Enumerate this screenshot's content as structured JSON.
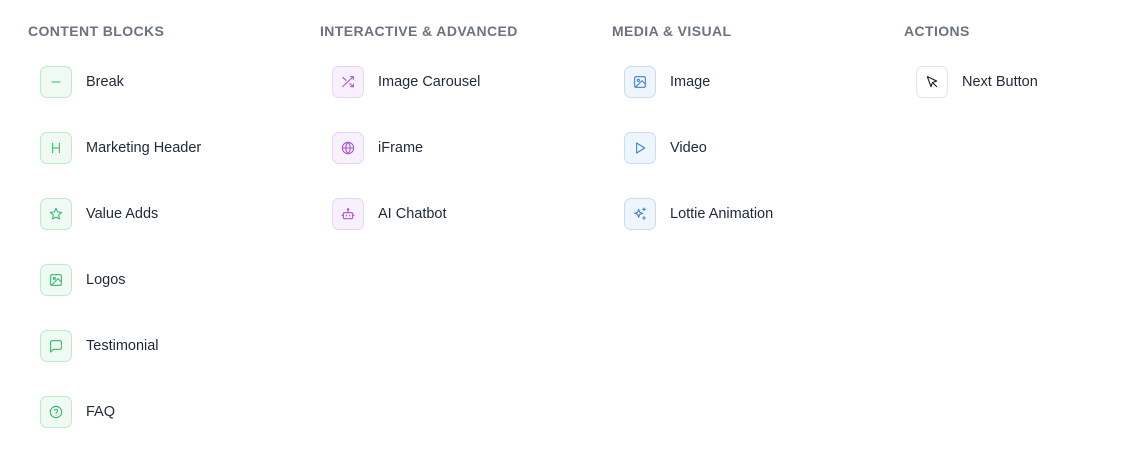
{
  "colors": {
    "content_accent": "#35b86a",
    "interactive_accent": "#a353d8",
    "media_accent": "#3d82cc",
    "actions_accent": "#111827",
    "heading_text": "#6b7280"
  },
  "columns": [
    {
      "title": "CONTENT BLOCKS",
      "items": [
        {
          "label": "Break",
          "icon": "minus-icon"
        },
        {
          "label": "Marketing Header",
          "icon": "heading-icon"
        },
        {
          "label": "Value Adds",
          "icon": "star-icon"
        },
        {
          "label": "Logos",
          "icon": "image-icon"
        },
        {
          "label": "Testimonial",
          "icon": "message-square-icon"
        },
        {
          "label": "FAQ",
          "icon": "help-circle-icon"
        }
      ]
    },
    {
      "title": "INTERACTIVE & ADVANCED",
      "items": [
        {
          "label": "Image Carousel",
          "icon": "shuffle-icon"
        },
        {
          "label": "iFrame",
          "icon": "globe-icon"
        },
        {
          "label": "AI Chatbot",
          "icon": "bot-icon"
        }
      ]
    },
    {
      "title": "MEDIA & VISUAL",
      "items": [
        {
          "label": "Image",
          "icon": "image-icon"
        },
        {
          "label": "Video",
          "icon": "play-icon"
        },
        {
          "label": "Lottie Animation",
          "icon": "sparkles-icon"
        }
      ]
    },
    {
      "title": "ACTIONS",
      "items": [
        {
          "label": "Next Button",
          "icon": "mouse-pointer-icon"
        }
      ]
    }
  ]
}
